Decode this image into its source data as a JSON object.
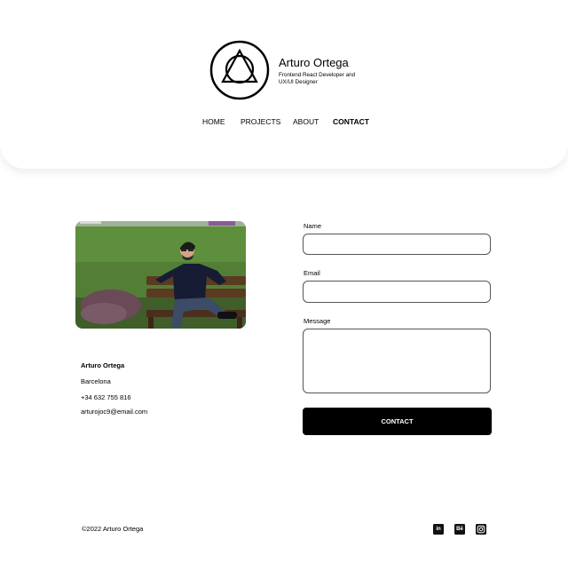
{
  "brand": {
    "name": "Arturo Ortega",
    "subtitle": "Frontend React Developer and UX/UI Designer"
  },
  "nav": {
    "items": [
      {
        "label": "HOME",
        "active": false
      },
      {
        "label": "PROJECTS",
        "active": false
      },
      {
        "label": "ABOUT",
        "active": false
      },
      {
        "label": "CONTACT",
        "active": true
      }
    ]
  },
  "contact_info": {
    "name": "Arturo Ortega",
    "city": "Barcelona",
    "phone": "+34 632 755 816",
    "email": "arturojoc9@email.com"
  },
  "form": {
    "name_label": "Name",
    "email_label": "Email",
    "message_label": "Message",
    "submit_label": "CONTACT"
  },
  "footer": {
    "copyright": "©2022 Arturo Ortega",
    "social": [
      {
        "icon": "linkedin-icon",
        "glyph": "in"
      },
      {
        "icon": "behance-icon",
        "glyph": "Bē"
      },
      {
        "icon": "instagram-icon",
        "glyph": ""
      }
    ]
  },
  "colors": {
    "primary": "#000000",
    "background": "#ffffff",
    "button_text": "#ffffff"
  }
}
